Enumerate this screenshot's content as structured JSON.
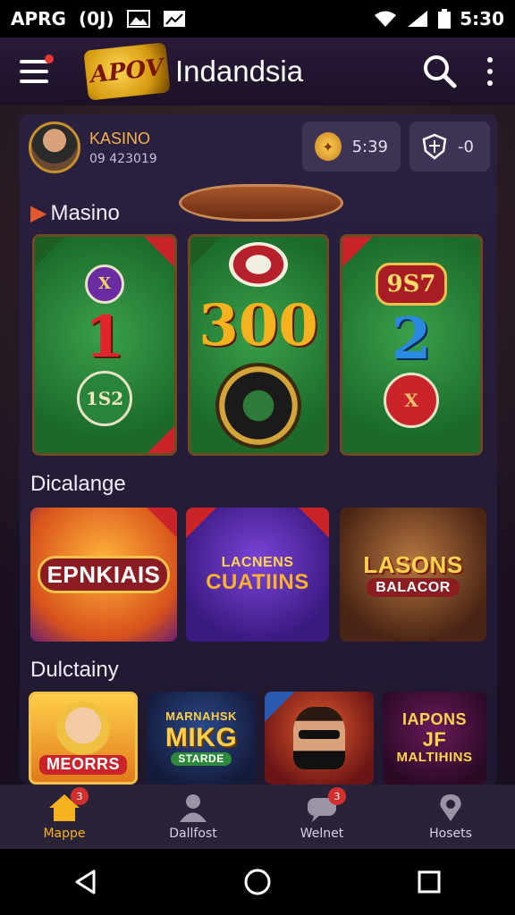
{
  "status_bar": {
    "left_text": "APRG",
    "left_mid": "(0J)",
    "time": "5:30"
  },
  "header": {
    "logo_text": "APOV",
    "title": "Indandsia"
  },
  "profile": {
    "name": "KASINO",
    "id": "09 423019"
  },
  "wallets": [
    {
      "icon": "coin-icon",
      "value": "5:39"
    },
    {
      "icon": "shield-icon",
      "value": "-0"
    }
  ],
  "sections": {
    "first": "Masino",
    "second": "Dicalange",
    "third": "Dulctainy"
  },
  "featured_tables": [
    {
      "number": "1",
      "chip": "1S2",
      "small_chip": "X"
    },
    {
      "number": "300"
    },
    {
      "number": "2",
      "plate": "9S7",
      "chip": "X"
    }
  ],
  "challenge_cards": [
    {
      "title": "EPNKIAIS"
    },
    {
      "title_line1": "LACNENS",
      "title_line2": "CUATIINS"
    },
    {
      "title_line1": "LASONS",
      "title_line2": "BALACOR"
    }
  ],
  "daily_cards": [
    {
      "title": "MEORRS"
    },
    {
      "title_line1": "MARNAHSK",
      "title_line2": "MIKG",
      "title_line3": "STARDE"
    },
    {
      "title": ""
    },
    {
      "title_line1": "IAPONS",
      "title_line2": "JF",
      "title_line3": "MALTIHINS"
    }
  ],
  "bottom_nav": [
    {
      "label": "Mappe",
      "icon": "home-icon",
      "badge": "3",
      "active": true
    },
    {
      "label": "Dallfost",
      "icon": "user-icon",
      "badge": "",
      "active": false
    },
    {
      "label": "Welnet",
      "icon": "chat-icon",
      "badge": "3",
      "active": false
    },
    {
      "label": "Hosets",
      "icon": "location-icon",
      "badge": "",
      "active": false
    }
  ],
  "colors": {
    "accent": "#f5b21e",
    "badge": "#d32f2f",
    "panel": "#2b2040"
  }
}
